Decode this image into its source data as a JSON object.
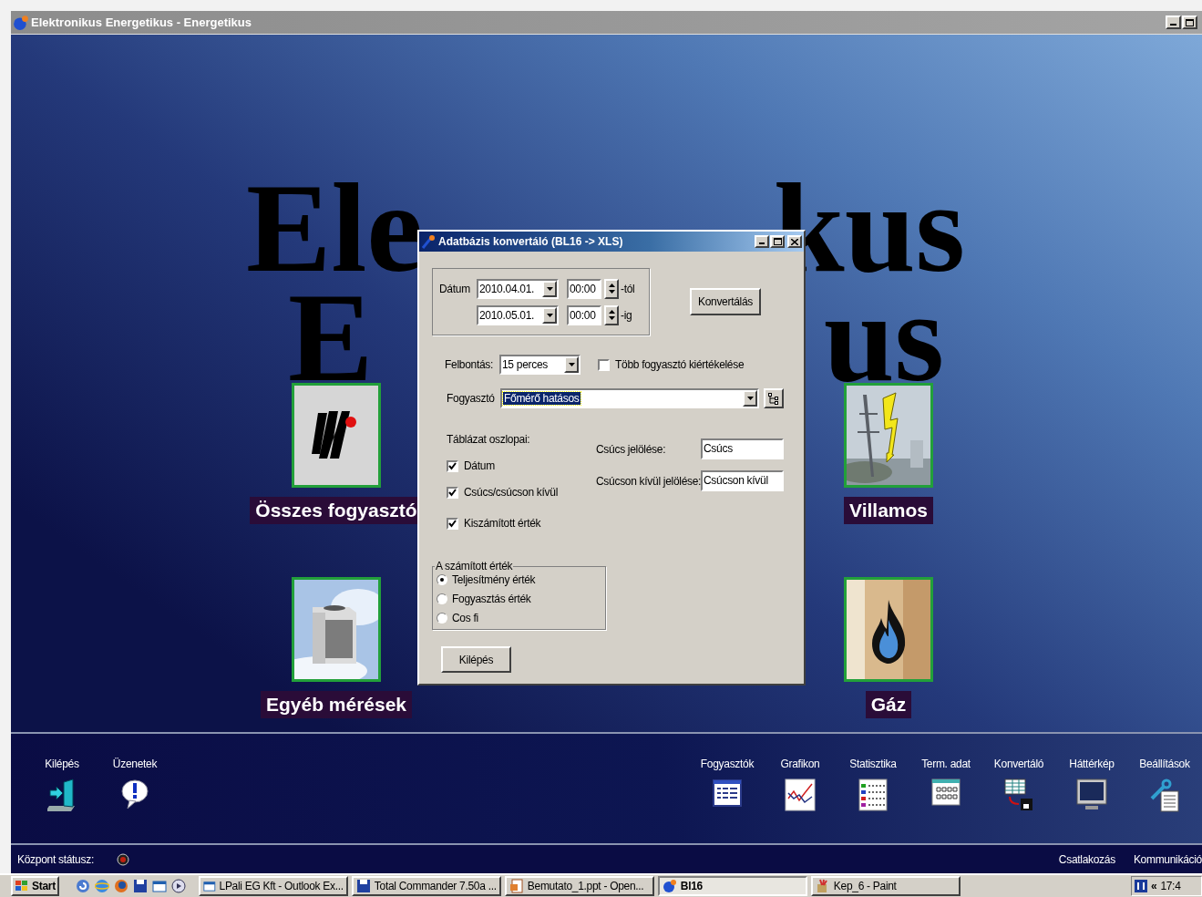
{
  "window": {
    "title": "Elektronikus Energetikus - Energetikus"
  },
  "heading": [
    {
      "left": "Ele",
      "right": "kus"
    },
    {
      "left": "E",
      "right": "us"
    }
  ],
  "tiles": [
    {
      "label": "Összes fogyasztó",
      "kind": "logo"
    },
    {
      "label": "Villamos",
      "kind": "power"
    },
    {
      "label": "Egyéb mérések",
      "kind": "unit"
    },
    {
      "label": "Gáz",
      "kind": "flame"
    }
  ],
  "dialog": {
    "title": "Adatbázis konvertáló (BL16 -> XLS)",
    "date_label": "Dátum",
    "date_rows": [
      {
        "date": "2010.04.01.",
        "time": "00:00",
        "suffix": "-tól"
      },
      {
        "date": "2010.05.01.",
        "time": "00:00",
        "suffix": "-ig"
      }
    ],
    "convert_button": "Konvertálás",
    "resolution": {
      "label": "Felbontás:",
      "value": "15 perces"
    },
    "multi": {
      "label": "Több fogyasztó kiértékelése",
      "checked": false
    },
    "consumer": {
      "label": "Fogyasztó",
      "value": "Főmérő hatásos"
    },
    "columns_title": "Táblázat oszlopai:",
    "columns": [
      {
        "label": "Dátum",
        "checked": true
      },
      {
        "label": "Csúcs/csúcson kívül",
        "checked": true
      },
      {
        "label": "Kiszámított érték",
        "checked": true
      }
    ],
    "fields": [
      {
        "label": "Csúcs jelölése:",
        "value": "Csúcs"
      },
      {
        "label": "Csúcson kívül jelölése:",
        "value": "Csúcson kívül"
      }
    ],
    "value_group": {
      "title": "A számított érték",
      "options": [
        {
          "label": "Teljesítmény érték",
          "selected": true
        },
        {
          "label": "Fogyasztás érték",
          "selected": false
        },
        {
          "label": "Cos fi",
          "selected": false
        }
      ]
    },
    "exit_button": "Kilépés"
  },
  "toolbar": {
    "left": [
      {
        "label": "Kilépés"
      },
      {
        "label": "Üzenetek"
      }
    ],
    "right": [
      {
        "label": "Fogyasztók"
      },
      {
        "label": "Grafikon"
      },
      {
        "label": "Statisztika"
      },
      {
        "label": "Term. adat"
      },
      {
        "label": "Konvertáló"
      },
      {
        "label": "Háttérkép"
      },
      {
        "label": "Beállítások"
      }
    ]
  },
  "status_bar": {
    "label": "Központ státusz:",
    "links": [
      "Csatlakozás",
      "Kommunikáció"
    ]
  },
  "taskbar": {
    "start": "Start",
    "tasks": [
      {
        "label": "LPali EG Kft - Outlook Ex...",
        "selected": false
      },
      {
        "label": "Total Commander 7.50a ...",
        "selected": false
      },
      {
        "label": "Bemutato_1.ppt - Open...",
        "selected": false
      },
      {
        "label": "Bl16",
        "selected": true
      },
      {
        "label": "Kep_6 - Paint",
        "selected": false
      }
    ],
    "tray": {
      "arrows": "«",
      "clock": "17:4"
    }
  }
}
